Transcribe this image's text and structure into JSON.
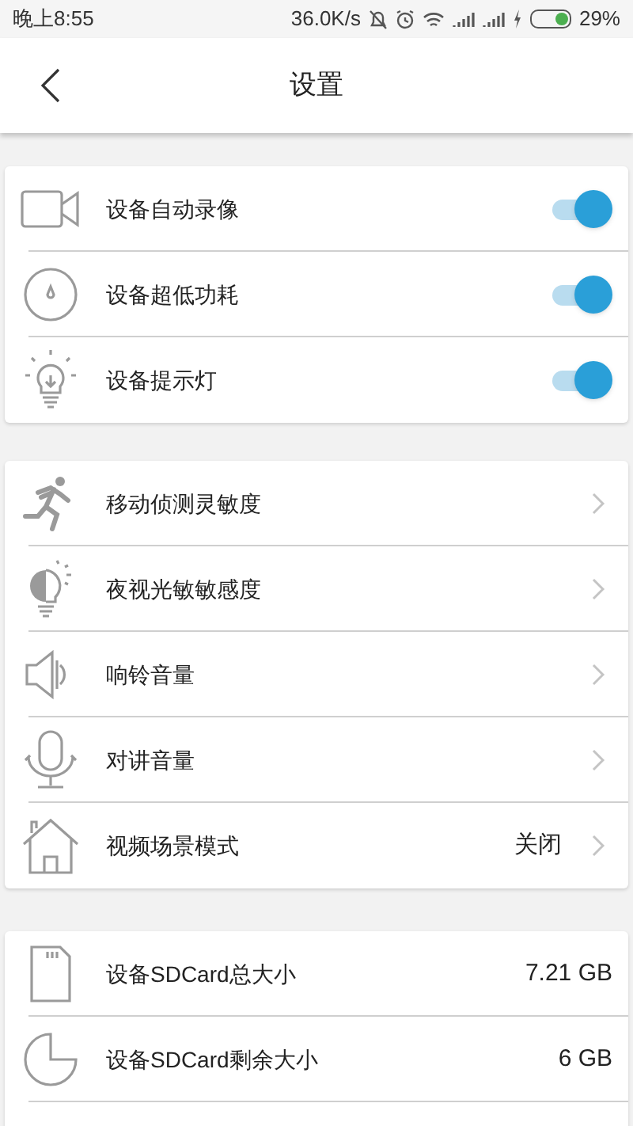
{
  "status_bar": {
    "time": "晚上8:55",
    "speed": "36.0K/s",
    "battery": "29%"
  },
  "header": {
    "title": "设置"
  },
  "toggles": [
    {
      "label": "设备自动录像",
      "kind": "camera",
      "on": true
    },
    {
      "label": "设备超低功耗",
      "kind": "power",
      "on": true
    },
    {
      "label": "设备提示灯",
      "kind": "bulb",
      "on": true
    }
  ],
  "menu": [
    {
      "label": "移动侦测灵敏度",
      "kind": "run"
    },
    {
      "label": "夜视光敏敏感度",
      "kind": "night"
    },
    {
      "label": "响铃音量",
      "kind": "speaker"
    },
    {
      "label": "对讲音量",
      "kind": "mic"
    },
    {
      "label": "视频场景模式",
      "kind": "home",
      "value": "关闭"
    }
  ],
  "storage": [
    {
      "label": "设备SDCard总大小",
      "kind": "sd",
      "value": "7.21 GB"
    },
    {
      "label": "设备SDCard剩余大小",
      "kind": "pie",
      "value": "6 GB"
    }
  ]
}
